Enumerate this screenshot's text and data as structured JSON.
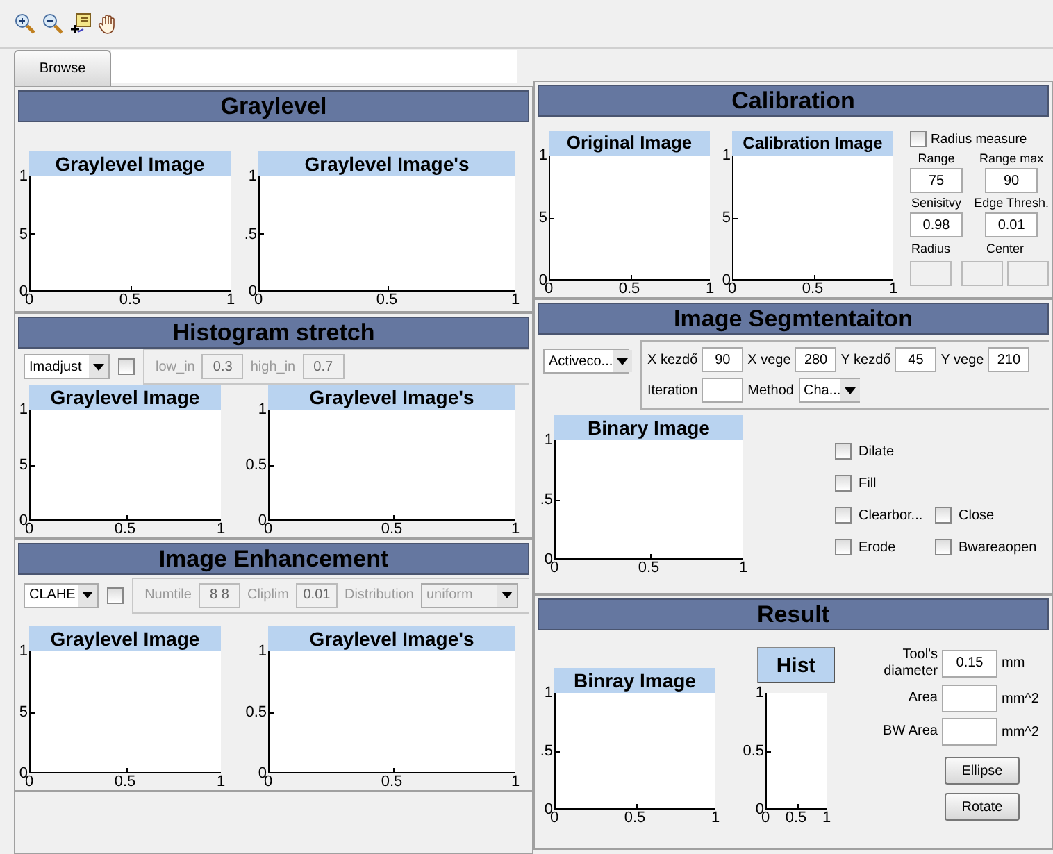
{
  "browse": {
    "label": "Browse"
  },
  "graylevel": {
    "title": "Graylevel",
    "axes": [
      {
        "title": "Graylevel Image",
        "yticks": [
          "1",
          "5",
          "0"
        ],
        "xticks": [
          "0",
          "0.5",
          "1"
        ]
      },
      {
        "title": "Graylevel Image's",
        "yticks": [
          "1",
          ".5",
          "0"
        ],
        "xticks": [
          "0",
          "0.5",
          "1"
        ]
      }
    ]
  },
  "histogram_stretch": {
    "title": "Histogram stretch",
    "method": "Imadjust",
    "enabled": {
      "checked": false
    },
    "options": {
      "disabled": true,
      "params": [
        {
          "kind": "field",
          "label": "low_in",
          "value": "0.3"
        },
        {
          "kind": "field",
          "label": "high_in",
          "value": "0.7"
        }
      ]
    },
    "axes": [
      {
        "title": "Graylevel Image",
        "yticks": [
          "1",
          "5",
          "0"
        ],
        "xticks": [
          "0",
          "0.5",
          "1"
        ]
      },
      {
        "title": "Graylevel Image's",
        "yticks": [
          "1",
          "0.5",
          "0"
        ],
        "xticks": [
          "0",
          "0.5",
          "1"
        ]
      }
    ]
  },
  "image_enhancement": {
    "title": "Image Enhancement",
    "method": "CLAHE",
    "enabled": {
      "checked": false
    },
    "options": {
      "disabled": true,
      "params": [
        {
          "kind": "field",
          "label": "Numtile",
          "value": "8 8"
        },
        {
          "kind": "field",
          "label": "Cliplim",
          "value": "0.01"
        },
        {
          "kind": "dropdown",
          "label": "Distribution",
          "value": "uniform"
        }
      ]
    },
    "axes": [
      {
        "title": "Graylevel Image",
        "yticks": [
          "1",
          "5",
          "0"
        ],
        "xticks": [
          "0",
          "0.5",
          "1"
        ]
      },
      {
        "title": "Graylevel Image's",
        "yticks": [
          "1",
          "0.5",
          "0"
        ],
        "xticks": [
          "0",
          "0.5",
          "1"
        ]
      }
    ]
  },
  "calibration": {
    "title": "Calibration",
    "axes": [
      {
        "title": "Original Image",
        "yticks": [
          "1",
          "5",
          "0"
        ],
        "xticks": [
          "0",
          "0.5",
          "1"
        ]
      },
      {
        "title": "Calibration Image",
        "yticks": [
          "1",
          "5",
          "0"
        ],
        "xticks": [
          "0",
          "0.5",
          "1"
        ]
      }
    ],
    "radius_measure": {
      "label": "Radius measure",
      "checked": false
    },
    "params": [
      {
        "label": "Range",
        "value": "75"
      },
      {
        "label": "Range max",
        "value": "90"
      },
      {
        "label": "Senisitvy",
        "value": "0.98"
      },
      {
        "label": "Edge Thresh.",
        "value": "0.01"
      }
    ],
    "outputs": [
      {
        "label": "Radius",
        "fields": [
          {
            "disabled": true
          }
        ]
      },
      {
        "label": "Center",
        "fields": [
          {
            "disabled": true
          },
          {
            "disabled": true
          }
        ]
      }
    ]
  },
  "segmentation": {
    "title": "Image Segmtentaiton",
    "method": "Activeco...",
    "params": [
      [
        {
          "kind": "field",
          "label": "X kezdő",
          "value": "90"
        },
        {
          "kind": "field",
          "label": "X vege",
          "value": "280"
        },
        {
          "kind": "field",
          "label": "Y kezdő",
          "value": "45"
        },
        {
          "kind": "field",
          "label": "Y vege",
          "value": "210"
        }
      ],
      [
        {
          "kind": "field",
          "label": "Iteration"
        },
        {
          "kind": "dropdown",
          "label": "Method",
          "value": "Cha..."
        }
      ]
    ],
    "axes": [
      {
        "title": "Binary Image",
        "yticks": [
          "1",
          ".5",
          "0"
        ],
        "xticks": [
          "0",
          "0.5",
          "1"
        ]
      }
    ],
    "option_rows": [
      [
        {
          "label": "Dilate",
          "checked": false
        }
      ],
      [
        {
          "label": "Fill",
          "checked": false
        }
      ],
      [
        {
          "label": "Clearbor...",
          "checked": false
        },
        {
          "label": "Close",
          "checked": false
        }
      ],
      [
        {
          "label": "Erode",
          "checked": false
        },
        {
          "label": "Bwareaopen",
          "checked": false
        }
      ]
    ]
  },
  "result": {
    "title": "Result",
    "axes": [
      {
        "title": "Binray Image",
        "yticks": [
          "1",
          ".5",
          "0"
        ],
        "xticks": [
          "0",
          "0.5",
          "1"
        ]
      },
      {
        "kind": "button",
        "title": "Hist",
        "yticks": [
          "1",
          "0.5",
          "0"
        ],
        "xticks": [
          "0",
          "0.5",
          "1"
        ]
      }
    ],
    "measures": [
      {
        "label": "Tool's diameter",
        "value": "0.15",
        "unit": "mm"
      },
      {
        "label": "Area",
        "unit": "mm^2"
      },
      {
        "label": "BW Area",
        "unit": "mm^2"
      }
    ],
    "buttons": [
      "Ellipse",
      "Rotate"
    ]
  }
}
